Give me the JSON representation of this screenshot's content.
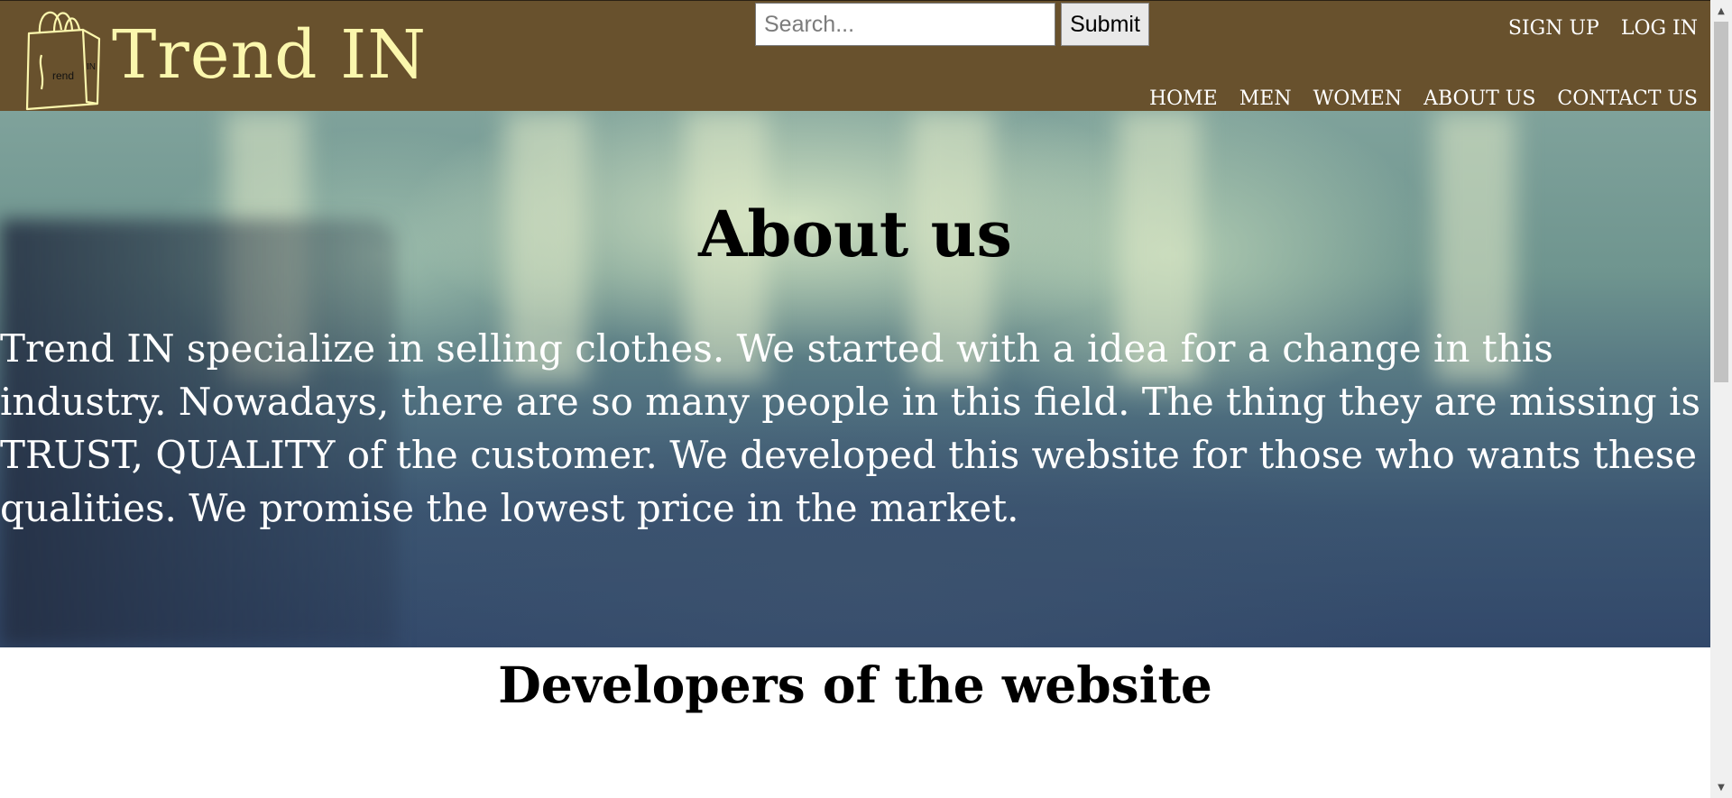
{
  "header": {
    "brand": "Trend IN",
    "logo_text_small": "IN",
    "logo_text": "rend",
    "search": {
      "placeholder": "Search...",
      "value": ""
    },
    "submit_label": "Submit",
    "top_links": [
      "SIGN UP",
      "LOG IN"
    ],
    "nav": [
      "HOME",
      "MEN",
      "WOMEN",
      "ABOUT US",
      "CONTACT US"
    ],
    "colors": {
      "bar": "#68512d",
      "brand": "#fbf7ad"
    }
  },
  "hero": {
    "title": "About us",
    "text": "Trend IN specialize in selling clothes. We started with a idea for a change in this industry. Nowadays, there are so many people in this field. The thing they are missing is TRUST, QUALITY of the customer. We developed this website for those who wants these qualities. We promise the lowest price in the market."
  },
  "developers": {
    "title": "Developers of the website"
  },
  "icons": {
    "logo": "shopping-bag-icon",
    "scroll_up": "chevron-up-icon",
    "scroll_down": "chevron-down-icon"
  }
}
